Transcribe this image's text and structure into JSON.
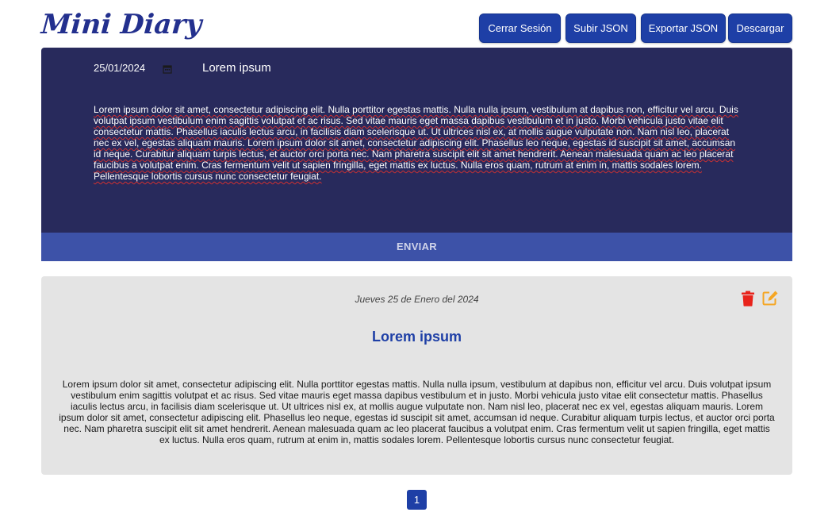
{
  "app": {
    "logo_text": "Mini Diary"
  },
  "header": {
    "buttons": {
      "logout": "Cerrar Sesión",
      "upload": "Subir JSON",
      "export": "Exportar JSON",
      "download": "Descargar"
    }
  },
  "editor": {
    "date_value": "25/01/2024",
    "title_value": "Lorem ipsum",
    "body_value": "Lorem ipsum dolor sit amet, consectetur adipiscing elit. Nulla porttitor egestas mattis. Nulla nulla ipsum, vestibulum at dapibus non, efficitur vel arcu. Duis volutpat ipsum vestibulum enim sagittis volutpat et ac risus. Sed vitae mauris eget massa dapibus vestibulum et in justo. Morbi vehicula justo vitae elit consectetur mattis. Phasellus iaculis lectus arcu, in facilisis diam scelerisque ut. Ut ultrices nisl ex, at mollis augue vulputate non. Nam nisl leo, placerat nec ex vel, egestas aliquam mauris. Lorem ipsum dolor sit amet, consectetur adipiscing elit. Phasellus leo neque, egestas id suscipit sit amet, accumsan id neque. Curabitur aliquam turpis lectus, et auctor orci porta nec. Nam pharetra suscipit elit sit amet hendrerit. Aenean malesuada quam ac leo placerat faucibus a volutpat enim. Cras fermentum velit ut sapien fringilla, eget mattis ex luctus. Nulla eros quam, rutrum at enim in, mattis sodales lorem. Pellentesque lobortis cursus nunc consectetur feugiat.",
    "send_label": "ENVIAR",
    "calendar_icon": "calendar-icon"
  },
  "entries": [
    {
      "date": "Jueves 25 de Enero del 2024",
      "title": "Lorem ipsum",
      "body": "Lorem ipsum dolor sit amet, consectetur adipiscing elit. Nulla porttitor egestas mattis. Nulla nulla ipsum, vestibulum at dapibus non, efficitur vel arcu. Duis volutpat ipsum vestibulum enim sagittis volutpat et ac risus. Sed vitae mauris eget massa dapibus vestibulum et in justo. Morbi vehicula justo vitae elit consectetur mattis. Phasellus iaculis lectus arcu, in facilisis diam scelerisque ut. Ut ultrices nisl ex, at mollis augue vulputate non. Nam nisl leo, placerat nec ex vel, egestas aliquam mauris. Lorem ipsum dolor sit amet, consectetur adipiscing elit. Phasellus leo neque, egestas id suscipit sit amet, accumsan id neque. Curabitur aliquam turpis lectus, et auctor orci porta nec. Nam pharetra suscipit elit sit amet hendrerit. Aenean malesuada quam ac leo placerat faucibus a volutpat enim. Cras fermentum velit ut sapien fringilla, eget mattis ex luctus. Nulla eros quam, rutrum at enim in, mattis sodales lorem. Pellentesque lobortis cursus nunc consectetur feugiat.",
      "delete_icon": "trash-icon",
      "edit_icon": "edit-icon"
    }
  ],
  "pagination": {
    "current_page": "1"
  },
  "colors": {
    "accent": "#1e3fa6",
    "editor_bg": "#282a5c",
    "send_bg": "#3d52a8",
    "card_bg": "#e4e4e4",
    "delete": "#e8231b",
    "edit": "#f5a623"
  }
}
